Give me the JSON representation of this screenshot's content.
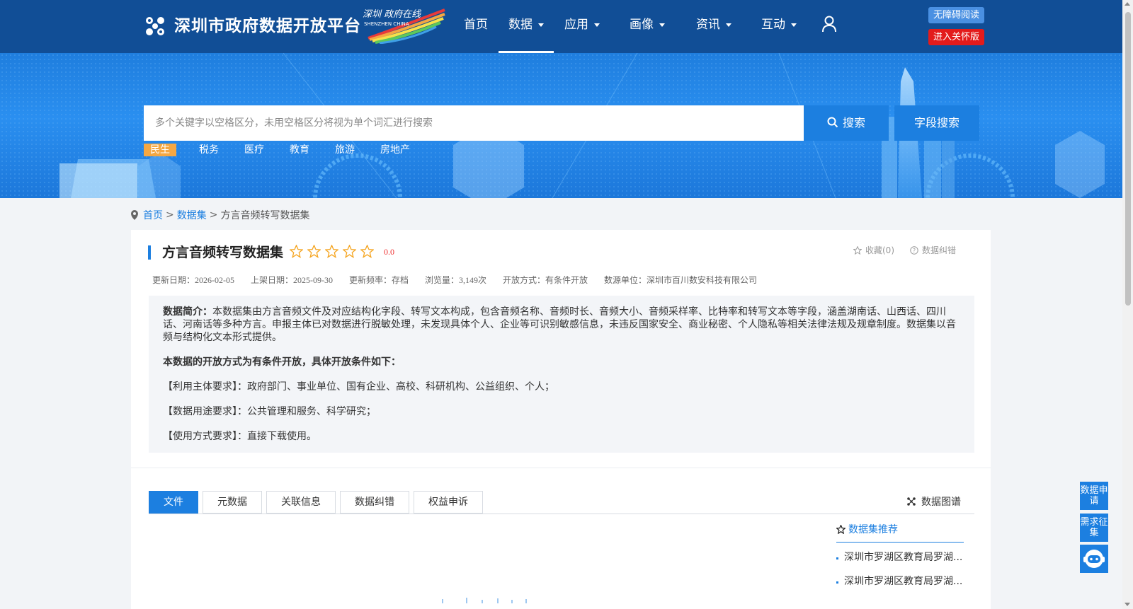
{
  "header": {
    "site_title": "深圳市政府数据开放平台",
    "sub_logo_text": "深圳 政府在线",
    "sub_logo_en": "SHENZHEN CHINA",
    "nav": [
      {
        "label": "首页",
        "has_caret": false,
        "active": false
      },
      {
        "label": "数据",
        "has_caret": true,
        "active": true
      },
      {
        "label": "应用",
        "has_caret": true,
        "active": false
      },
      {
        "label": "画像",
        "has_caret": true,
        "active": false
      },
      {
        "label": "资讯",
        "has_caret": true,
        "active": false
      },
      {
        "label": "互动",
        "has_caret": true,
        "active": false
      }
    ],
    "user_icon": "user-icon",
    "accessibility_label": "无障碍阅读",
    "care_mode_label": "进入关怀版"
  },
  "banner": {
    "search_placeholder": "多个关键字以空格区分，未用空格区分将视为单个词汇进行搜索",
    "search_label": "搜索",
    "field_search_label": "字段搜索",
    "hot_tags": [
      "民生",
      "税务",
      "医疗",
      "教育",
      "旅游",
      "房地产"
    ],
    "active_tag": "民生"
  },
  "breadcrumb": {
    "home": "首页",
    "datasets": "数据集",
    "current": "方言音频转写数据集",
    "sep": ">"
  },
  "dataset": {
    "title": "方言音频转写数据集",
    "rating": 0,
    "score_text": "0.0",
    "favorite_label": "收藏(0)",
    "correction_label": "数据纠错",
    "meta": [
      "更新日期：2026-02-05",
      "上架日期：2025-09-30",
      "更新频率：存档",
      "浏览量：3,149次",
      "开放方式：有条件开放",
      "数源单位：深圳市百川数安科技有限公司"
    ],
    "summary_label": "数据简介：",
    "summary_text": "本数据集由方言音频文件及对应结构化字段、转写文本构成，包含音频名称、音频时长、音频大小、音频采样率、比特率和转写文本等字段，涵盖湖南话、山西话、四川话、河南话等多种方言。申报主体已对数据进行脱敏处理，未发现具体个人、企业等可识别敏感信息，未违反国家安全、商业秘密、个人隐私等相关法律法规及规章制度。数据集以音频与结构化文本形式提供。",
    "open_condition_heading": "本数据的开放方式为有条件开放，具体开放条件如下：",
    "conditions": [
      "【利用主体要求】：政府部门、事业单位、国有企业、高校、科研机构、公益组织、个人；",
      "【数据用途要求】：公共管理和服务、科学研究；",
      "【使用方式要求】：直接下载使用。"
    ]
  },
  "tabs": {
    "items": [
      "文件",
      "元数据",
      "关联信息",
      "数据纠错",
      "权益申诉"
    ],
    "active": "文件",
    "graph_label": "数据图谱"
  },
  "recommend": {
    "title": "数据集推荐",
    "items": [
      "深圳市罗湖区教育局罗湖...",
      "深圳市罗湖区教育局罗湖..."
    ]
  },
  "float": {
    "apply": "数据申请",
    "demand": "需求征集",
    "robot_icon": "robot-icon"
  },
  "colors": {
    "header_bg": "#114e96",
    "accent": "#1c7fe0",
    "care_red": "#e31b1b",
    "tag_orange": "#f5a742"
  }
}
